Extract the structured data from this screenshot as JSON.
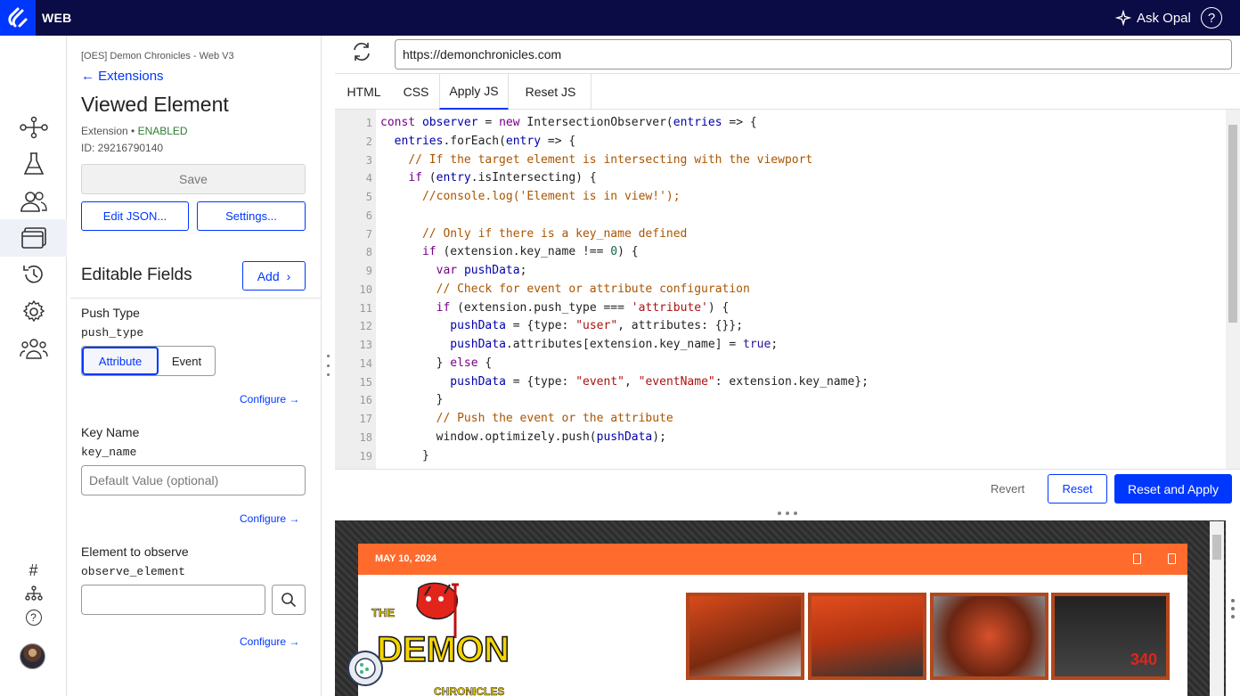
{
  "app": {
    "name": "WEB",
    "ask_opal": "Ask Opal",
    "help": "?"
  },
  "rail": {
    "bottom_hash": "#",
    "bottom_help": "?"
  },
  "panel": {
    "project": "[OES] Demon Chronicles - Web V3",
    "back_label": "Extensions",
    "title": "Viewed Element",
    "type_label": "Extension •",
    "status": "ENABLED",
    "id_text": "ID: 29216790140",
    "save_label": "Save",
    "edit_json_label": "Edit JSON...",
    "settings_label": "Settings...",
    "editable_fields_title": "Editable Fields",
    "add_label": "Add",
    "fields": [
      {
        "label": "Push Type",
        "key": "push_type",
        "options": [
          "Attribute",
          "Event"
        ],
        "selected": "Attribute",
        "configure": "Configure"
      },
      {
        "label": "Key Name",
        "key": "key_name",
        "placeholder": "Default Value (optional)",
        "configure": "Configure"
      },
      {
        "label": "Element to observe",
        "key": "observe_element",
        "value": "",
        "configure": "Configure"
      }
    ]
  },
  "browser": {
    "url": "https://demonchronicles.com"
  },
  "tabs": [
    "HTML",
    "CSS",
    "Apply JS",
    "Reset JS"
  ],
  "active_tab": "Apply JS",
  "code_lines": [
    "const observer = new IntersectionObserver(entries => {",
    "  entries.forEach(entry => {",
    "    // If the target element is intersecting with the viewport",
    "    if (entry.isIntersecting) {",
    "      //console.log('Element is in view!');",
    "",
    "      // Only if there is a key_name defined",
    "      if (extension.key_name !== 0) {",
    "        var pushData;",
    "        // Check for event or attribute configuration",
    "        if (extension.push_type === 'attribute') {",
    "          pushData = {type: \"user\", attributes: {}};",
    "          pushData.attributes[extension.key_name] = true;",
    "        } else {",
    "          pushData = {type: \"event\", \"eventName\": extension.key_name};",
    "        }",
    "        // Push the event or the attribute",
    "        window.optimizely.push(pushData);",
    "      }"
  ],
  "actions": {
    "revert": "Revert",
    "reset": "Reset",
    "reset_apply": "Reset and Apply"
  },
  "preview": {
    "date": "MAY 10, 2024",
    "logo_line1": "THE",
    "logo_line2": "DEMON",
    "logo_line3": "CHRONICLES",
    "thumb4_text": "340"
  },
  "colors": {
    "brand_blue": "#0037ff",
    "topbar": "#0b0b45",
    "site_orange": "#ff6b2d",
    "enabled_green": "#2e7d32"
  }
}
